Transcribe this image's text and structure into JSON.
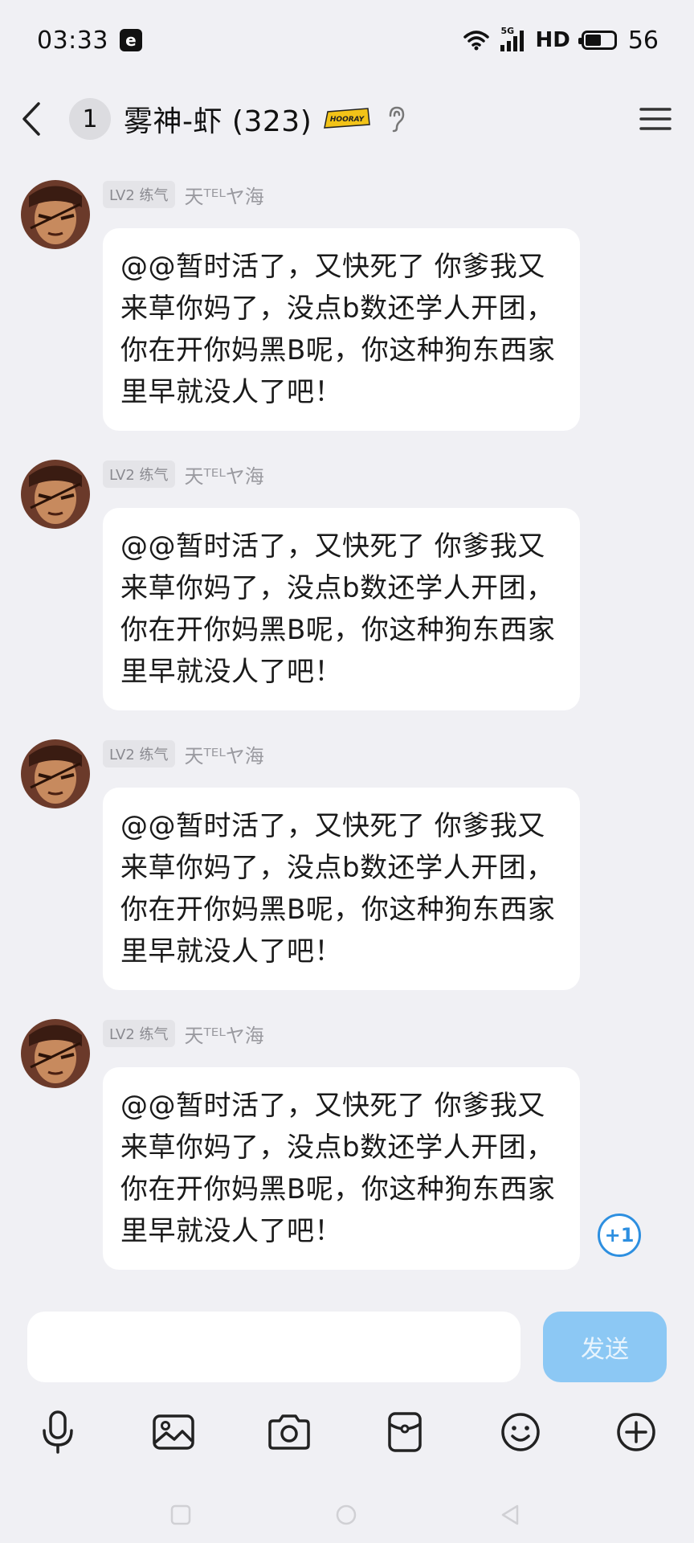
{
  "status_bar": {
    "time": "03:33",
    "app_icon_letter": "e",
    "network": "5G",
    "hd": "HD",
    "battery": "56",
    "battery_fraction": 0.56
  },
  "header": {
    "unread_count": "1",
    "title": "雾神-虾 (323)",
    "badge_text": "HOORAY"
  },
  "messages": [
    {
      "level": "LV2 练气",
      "sender": "天ᵀᴱᴸヤ海",
      "text": "@@暂时活了，又快死了 你爹我又来草你妈了，没点b数还学人开团，你在开你妈黑B呢，你这种狗东西家里早就没人了吧！"
    },
    {
      "level": "LV2 练气",
      "sender": "天ᵀᴱᴸヤ海",
      "text": "@@暂时活了，又快死了 你爹我又来草你妈了，没点b数还学人开团，你在开你妈黑B呢，你这种狗东西家里早就没人了吧！"
    },
    {
      "level": "LV2 练气",
      "sender": "天ᵀᴱᴸヤ海",
      "text": "@@暂时活了，又快死了 你爹我又来草你妈了，没点b数还学人开团，你在开你妈黑B呢，你这种狗东西家里早就没人了吧！"
    },
    {
      "level": "LV2 练气",
      "sender": "天ᵀᴱᴸヤ海",
      "text": "@@暂时活了，又快死了 你爹我又来草你妈了，没点b数还学人开团，你在开你妈黑B呢，你这种狗东西家里早就没人了吧！"
    }
  ],
  "plus_one": "+1",
  "input": {
    "placeholder": "",
    "send_label": "发送"
  },
  "toolbar": [
    "microphone-icon",
    "image-icon",
    "camera-icon",
    "red-packet-icon",
    "emoji-icon",
    "plus-icon"
  ],
  "colors": {
    "background": "#f0f0f4",
    "send_button": "#8cc8f4",
    "accent_blue": "#2d8fe0"
  }
}
